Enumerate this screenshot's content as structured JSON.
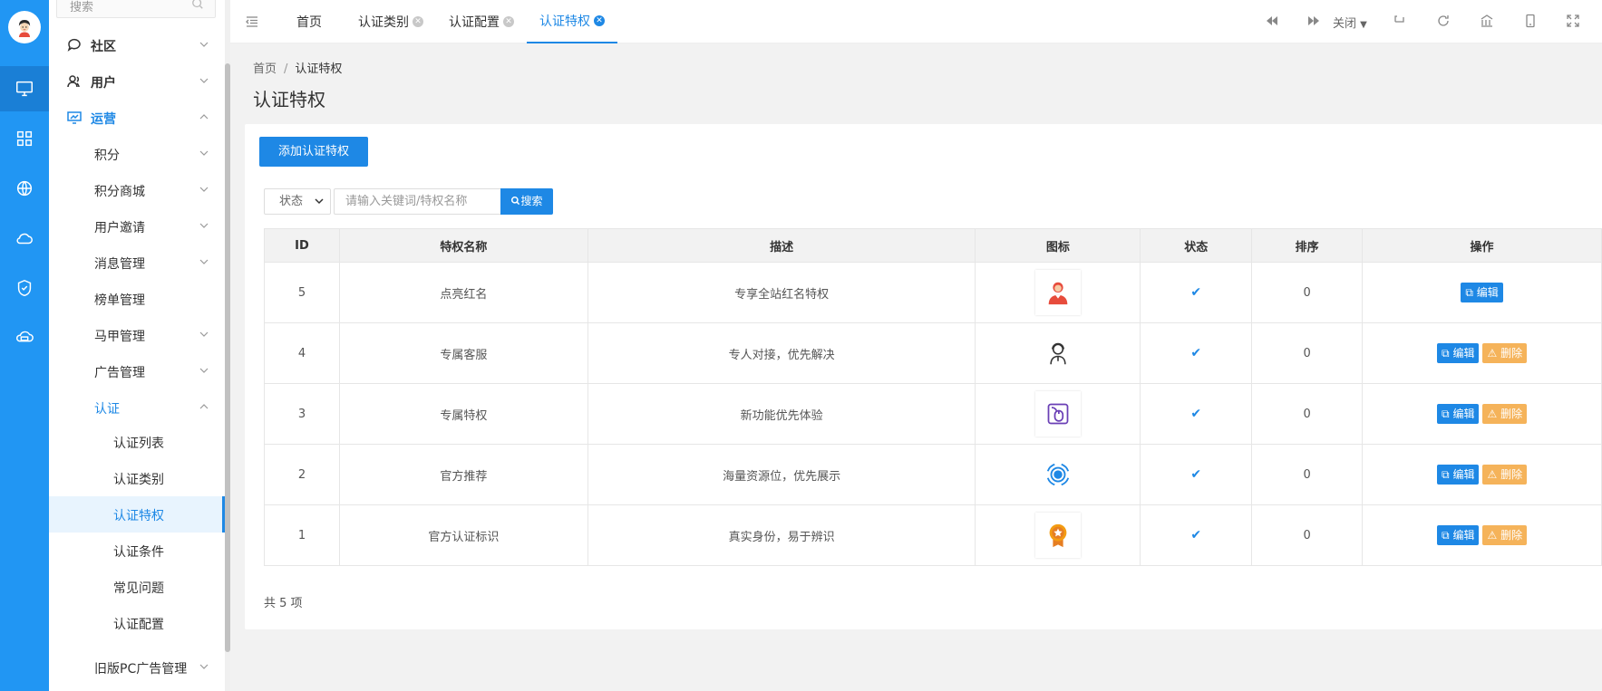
{
  "sidebar": {
    "search_placeholder": "搜索",
    "items": [
      {
        "label": "社区",
        "icon": "chat-icon"
      },
      {
        "label": "用户",
        "icon": "users-icon"
      },
      {
        "label": "运营",
        "icon": "monitor-chart-icon"
      },
      {
        "label": "积分"
      },
      {
        "label": "积分商城"
      },
      {
        "label": "用户邀请"
      },
      {
        "label": "消息管理"
      },
      {
        "label": "榜单管理"
      },
      {
        "label": "马甲管理"
      },
      {
        "label": "广告管理"
      },
      {
        "label": "认证"
      },
      {
        "label": "认证列表"
      },
      {
        "label": "认证类别"
      },
      {
        "label": "认证特权"
      },
      {
        "label": "认证条件"
      },
      {
        "label": "常见问题"
      },
      {
        "label": "认证配置"
      },
      {
        "label": "旧版PC广告管理"
      }
    ]
  },
  "tabs": [
    {
      "label": "首页"
    },
    {
      "label": "认证类别"
    },
    {
      "label": "认证配置"
    },
    {
      "label": "认证特权"
    }
  ],
  "toolbar": {
    "close_label": "关闭"
  },
  "breadcrumb": {
    "home": "首页",
    "current": "认证特权"
  },
  "page_title": "认证特权",
  "actions": {
    "add_label": "添加认证特权"
  },
  "filter": {
    "status_label": "状态",
    "keyword_placeholder": "请输入关键词/特权名称",
    "search_label": "搜索"
  },
  "table": {
    "headers": [
      "ID",
      "特权名称",
      "描述",
      "图标",
      "状态",
      "排序",
      "操作"
    ],
    "rows": [
      {
        "id": "5",
        "name": "点亮红名",
        "desc": "专享全站红名特权",
        "icon": "red-name-person-icon",
        "sort": "0",
        "edit": "编辑",
        "delete": ""
      },
      {
        "id": "4",
        "name": "专属客服",
        "desc": "专人对接，优先解决",
        "icon": "customer-service-icon",
        "sort": "0",
        "edit": "编辑",
        "delete": "删除"
      },
      {
        "id": "3",
        "name": "专属特权",
        "desc": "新功能优先体验",
        "icon": "mouse-icon",
        "sort": "0",
        "edit": "编辑",
        "delete": "删除"
      },
      {
        "id": "2",
        "name": "官方推荐",
        "desc": "海量资源位，优先展示",
        "icon": "target-icon",
        "sort": "0",
        "edit": "编辑",
        "delete": "删除"
      },
      {
        "id": "1",
        "name": "官方认证标识",
        "desc": "真实身份，易于辨识",
        "icon": "medal-icon",
        "sort": "0",
        "edit": "编辑",
        "delete": "删除"
      }
    ]
  },
  "total_text": "共 5 项",
  "colors": {
    "primary": "#1e88e5",
    "warning": "#f5b35a",
    "rail": "#2196f3"
  }
}
